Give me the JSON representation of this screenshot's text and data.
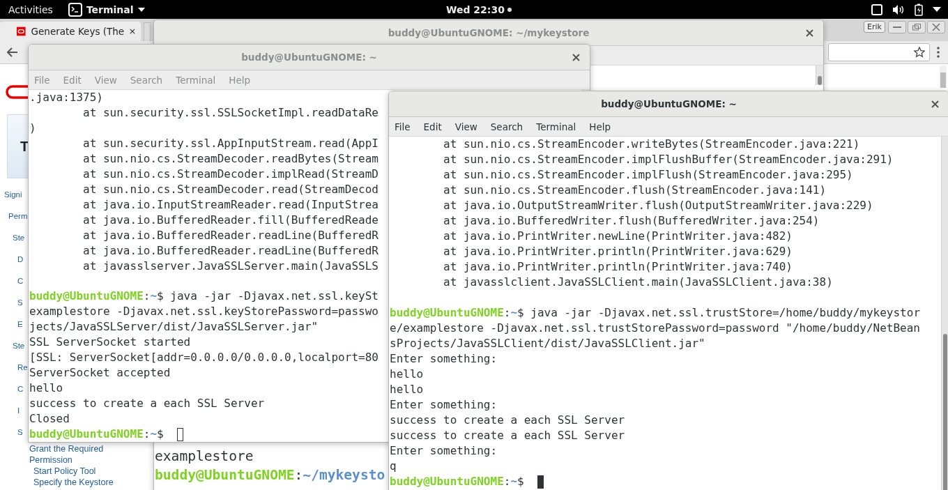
{
  "top_bar": {
    "activities": "Activities",
    "app_menu": "Terminal",
    "clock": "Wed 22:30"
  },
  "browser": {
    "tab": {
      "title": "Generate Keys (The",
      "selected": true
    },
    "profile": "Erik",
    "heading": "T",
    "toc": [
      {
        "text": "Signi",
        "children": [
          {
            "text": "Perm",
            "children": [
              {
                "text": "Ste",
                "children": [
                  {
                    "text": "D"
                  },
                  {
                    "text": "C"
                  },
                  {
                    "text": "S"
                  },
                  {
                    "text": "E"
                  }
                ]
              },
              {
                "text": "Ste",
                "children": [
                  {
                    "text": "Re"
                  },
                  {
                    "text": "C"
                  },
                  {
                    "text": "I"
                  },
                  {
                    "text": "S",
                    "children": [
                      {
                        "text": "Grant the Required Permission",
                        "children": [
                          {
                            "text": "Start Policy Tool"
                          },
                          {
                            "text": "Specify the Keystore"
                          }
                        ]
                      }
                    ]
                  }
                ]
              }
            ]
          }
        ]
      }
    ]
  },
  "terminals": [
    {
      "title": "buddy@UbuntuGNOME: ~/mykeystore",
      "focused": false,
      "lines": [
        {
          "kind": "out",
          "text": "examplestore"
        },
        {
          "kind": "prompt",
          "user": "buddy@UbuntuGNOME",
          "sep": ":",
          "path": "~/mykeysto"
        }
      ]
    },
    {
      "title": "buddy@UbuntuGNOME: ~",
      "focused": false,
      "menu": [
        "File",
        "Edit",
        "View",
        "Search",
        "Terminal",
        "Help"
      ],
      "lines": [
        {
          "kind": "out",
          "text": ".java:1375)"
        },
        {
          "kind": "out",
          "text": "        at sun.security.ssl.SSLSocketImpl.readDataRe"
        },
        {
          "kind": "out",
          "text": ")"
        },
        {
          "kind": "out",
          "text": "        at sun.security.ssl.AppInputStream.read(AppI"
        },
        {
          "kind": "out",
          "text": "        at sun.nio.cs.StreamDecoder.readBytes(Stream"
        },
        {
          "kind": "out",
          "text": "        at sun.nio.cs.StreamDecoder.implRead(StreamD"
        },
        {
          "kind": "out",
          "text": "        at sun.nio.cs.StreamDecoder.read(StreamDecod"
        },
        {
          "kind": "out",
          "text": "        at java.io.InputStreamReader.read(InputStrea"
        },
        {
          "kind": "out",
          "text": "        at java.io.BufferedReader.fill(BufferedReade"
        },
        {
          "kind": "out",
          "text": "        at java.io.BufferedReader.readLine(BufferedR"
        },
        {
          "kind": "out",
          "text": "        at java.io.BufferedReader.readLine(BufferedR"
        },
        {
          "kind": "out",
          "text": "        at javasslserver.JavaSSLServer.main(JavaSSLS"
        },
        {
          "kind": "blank"
        },
        {
          "kind": "prompt",
          "user": "buddy@UbuntuGNOME",
          "sep": ":",
          "path": "~",
          "mark": "$",
          "command": "java -jar -Djavax.net.ssl.keySt"
        },
        {
          "kind": "out",
          "text": "examplestore -Djavax.net.ssl.keyStorePassword=passwo"
        },
        {
          "kind": "out",
          "text": "jects/JavaSSLServer/dist/JavaSSLServer.jar\""
        },
        {
          "kind": "out",
          "text": "SSL ServerSocket started"
        },
        {
          "kind": "out",
          "text": "[SSL: ServerSocket[addr=0.0.0.0/0.0.0.0,localport=80"
        },
        {
          "kind": "out",
          "text": "ServerSocket accepted"
        },
        {
          "kind": "out",
          "text": "hello"
        },
        {
          "kind": "out",
          "text": "success to create a each SSL Server"
        },
        {
          "kind": "out",
          "text": "Closed"
        },
        {
          "kind": "prompt",
          "user": "buddy@UbuntuGNOME",
          "sep": ":",
          "path": "~",
          "mark": "$",
          "cursor": true
        }
      ]
    },
    {
      "title": "buddy@UbuntuGNOME: ~",
      "focused": true,
      "menu": [
        "File",
        "Edit",
        "View",
        "Search",
        "Terminal",
        "Help"
      ],
      "lines": [
        {
          "kind": "out",
          "text": "        at sun.nio.cs.StreamEncoder.writeBytes(StreamEncoder.java:221)"
        },
        {
          "kind": "out",
          "text": "        at sun.nio.cs.StreamEncoder.implFlushBuffer(StreamEncoder.java:291)"
        },
        {
          "kind": "out",
          "text": "        at sun.nio.cs.StreamEncoder.implFlush(StreamEncoder.java:295)"
        },
        {
          "kind": "out",
          "text": "        at sun.nio.cs.StreamEncoder.flush(StreamEncoder.java:141)"
        },
        {
          "kind": "out",
          "text": "        at java.io.OutputStreamWriter.flush(OutputStreamWriter.java:229)"
        },
        {
          "kind": "out",
          "text": "        at java.io.BufferedWriter.flush(BufferedWriter.java:254)"
        },
        {
          "kind": "out",
          "text": "        at java.io.PrintWriter.newLine(PrintWriter.java:482)"
        },
        {
          "kind": "out",
          "text": "        at java.io.PrintWriter.println(PrintWriter.java:629)"
        },
        {
          "kind": "out",
          "text": "        at java.io.PrintWriter.println(PrintWriter.java:740)"
        },
        {
          "kind": "out",
          "text": "        at javasslclient.JavaSSLClient.main(JavaSSLClient.java:38)"
        },
        {
          "kind": "blank"
        },
        {
          "kind": "prompt",
          "user": "buddy@UbuntuGNOME",
          "sep": ":",
          "path": "~",
          "mark": "$",
          "command": "java -jar -Djavax.net.ssl.trustStore=/home/buddy/mykeystor"
        },
        {
          "kind": "out",
          "text": "e/examplestore -Djavax.net.ssl.trustStorePassword=password \"/home/buddy/NetBean"
        },
        {
          "kind": "out",
          "text": "sProjects/JavaSSLClient/dist/JavaSSLClient.jar\""
        },
        {
          "kind": "out",
          "text": "Enter something:"
        },
        {
          "kind": "out",
          "text": "hello"
        },
        {
          "kind": "out",
          "text": "hello"
        },
        {
          "kind": "out",
          "text": "Enter something:"
        },
        {
          "kind": "out",
          "text": "success to create a each SSL Server"
        },
        {
          "kind": "out",
          "text": "success to create a each SSL Server"
        },
        {
          "kind": "out",
          "text": "Enter something:"
        },
        {
          "kind": "out",
          "text": "q"
        },
        {
          "kind": "prompt",
          "user": "buddy@UbuntuGNOME",
          "sep": ":",
          "path": "~",
          "mark": "$",
          "cursor": true
        }
      ]
    }
  ]
}
